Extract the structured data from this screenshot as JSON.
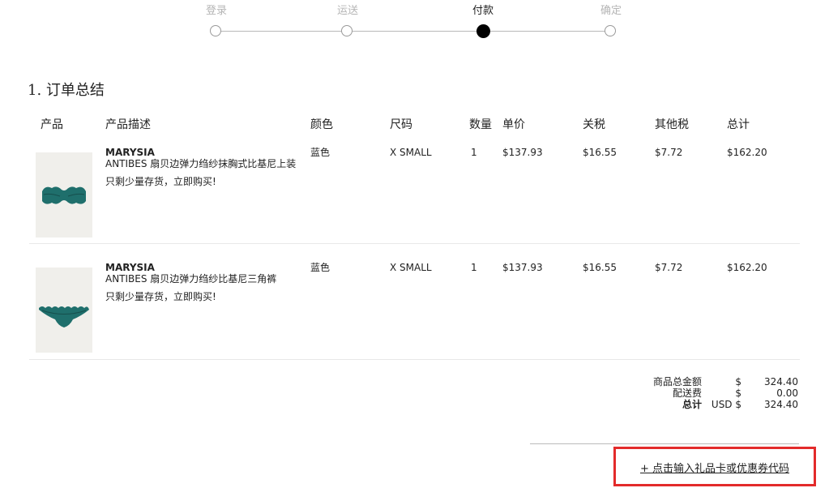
{
  "stepper": {
    "steps": [
      {
        "label": "登录",
        "state": "inactive"
      },
      {
        "label": "运送",
        "state": "inactive"
      },
      {
        "label": "付款",
        "state": "active"
      },
      {
        "label": "确定",
        "state": "inactive"
      }
    ]
  },
  "section": {
    "title": "1. 订单总结"
  },
  "table": {
    "headers": {
      "product": "产品",
      "description": "产品描述",
      "color": "颜色",
      "size": "尺码",
      "qty": "数量",
      "unit_price": "单价",
      "duty": "关税",
      "other_tax": "其他税",
      "total": "总计"
    },
    "rows": [
      {
        "brand": "MARYSIA",
        "name": "ANTIBES 扇贝边弹力绉纱抹胸式比基尼上装",
        "stock": "只剩少量存货，立即购买!",
        "color": "蓝色",
        "size": "X SMALL",
        "qty": "1",
        "unit_price": "$137.93",
        "duty": "$16.55",
        "other_tax": "$7.72",
        "total": "$162.20",
        "image": "teal-bikini-top-thumbnail"
      },
      {
        "brand": "MARYSIA",
        "name": "ANTIBES 扇贝边弹力绉纱比基尼三角裤",
        "stock": "只剩少量存货，立即购买!",
        "color": "蓝色",
        "size": "X SMALL",
        "qty": "1",
        "unit_price": "$137.93",
        "duty": "$16.55",
        "other_tax": "$7.72",
        "total": "$162.20",
        "image": "teal-bikini-bottom-thumbnail"
      }
    ]
  },
  "summary": {
    "subtotal_label": "商品总金额",
    "subtotal_currency": "$",
    "subtotal_value": "324.40",
    "shipping_label": "配送费",
    "shipping_currency": "$",
    "shipping_value": "0.00",
    "total_label": "总计",
    "total_currency": "USD $",
    "total_value": "324.40"
  },
  "coupon": {
    "link_text": "+ 点击输入礼品卡或优惠券代码",
    "highlight_color": "#e32b2b"
  },
  "colors": {
    "product_teal": "#1f6f6c",
    "inactive_step": "#b5b5b5"
  }
}
